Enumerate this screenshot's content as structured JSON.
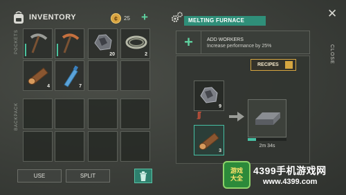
{
  "inventory": {
    "title": "INVENTORY",
    "coins": "25",
    "pockets_label": "POCKETS",
    "backpack_label": "BACKPACK",
    "pockets": [
      {
        "item": "pickaxe-stone",
        "count": ""
      },
      {
        "item": "pickaxe-iron",
        "count": ""
      },
      {
        "item": "coal",
        "count": "20"
      },
      {
        "item": "rope",
        "count": "2"
      },
      {
        "item": "wood-log",
        "count": "4"
      },
      {
        "item": "water-bottle",
        "count": "7"
      },
      {
        "item": "empty",
        "count": ""
      },
      {
        "item": "empty",
        "count": ""
      }
    ],
    "backpack_slots": 8,
    "use_label": "USE",
    "split_label": "SPLIT"
  },
  "furnace": {
    "title": "MELTING FURNACE",
    "close_label": "CLOSE",
    "add_workers_title": "ADD WORKERS",
    "add_workers_sub": "Increase performance by 25%",
    "recipes_label": "RECIPES",
    "input_count": "9",
    "fuel_count": "3",
    "timer": "2m 34s",
    "progress": 0.22
  },
  "watermark": {
    "badge_line1": "游戏",
    "badge_line2": "大全",
    "site_name": "4399手机游戏网",
    "url": "www.4399.com"
  },
  "colors": {
    "accent": "#47c0a4",
    "title_bg": "#2f8f79",
    "recipes_border": "#d6a640"
  }
}
